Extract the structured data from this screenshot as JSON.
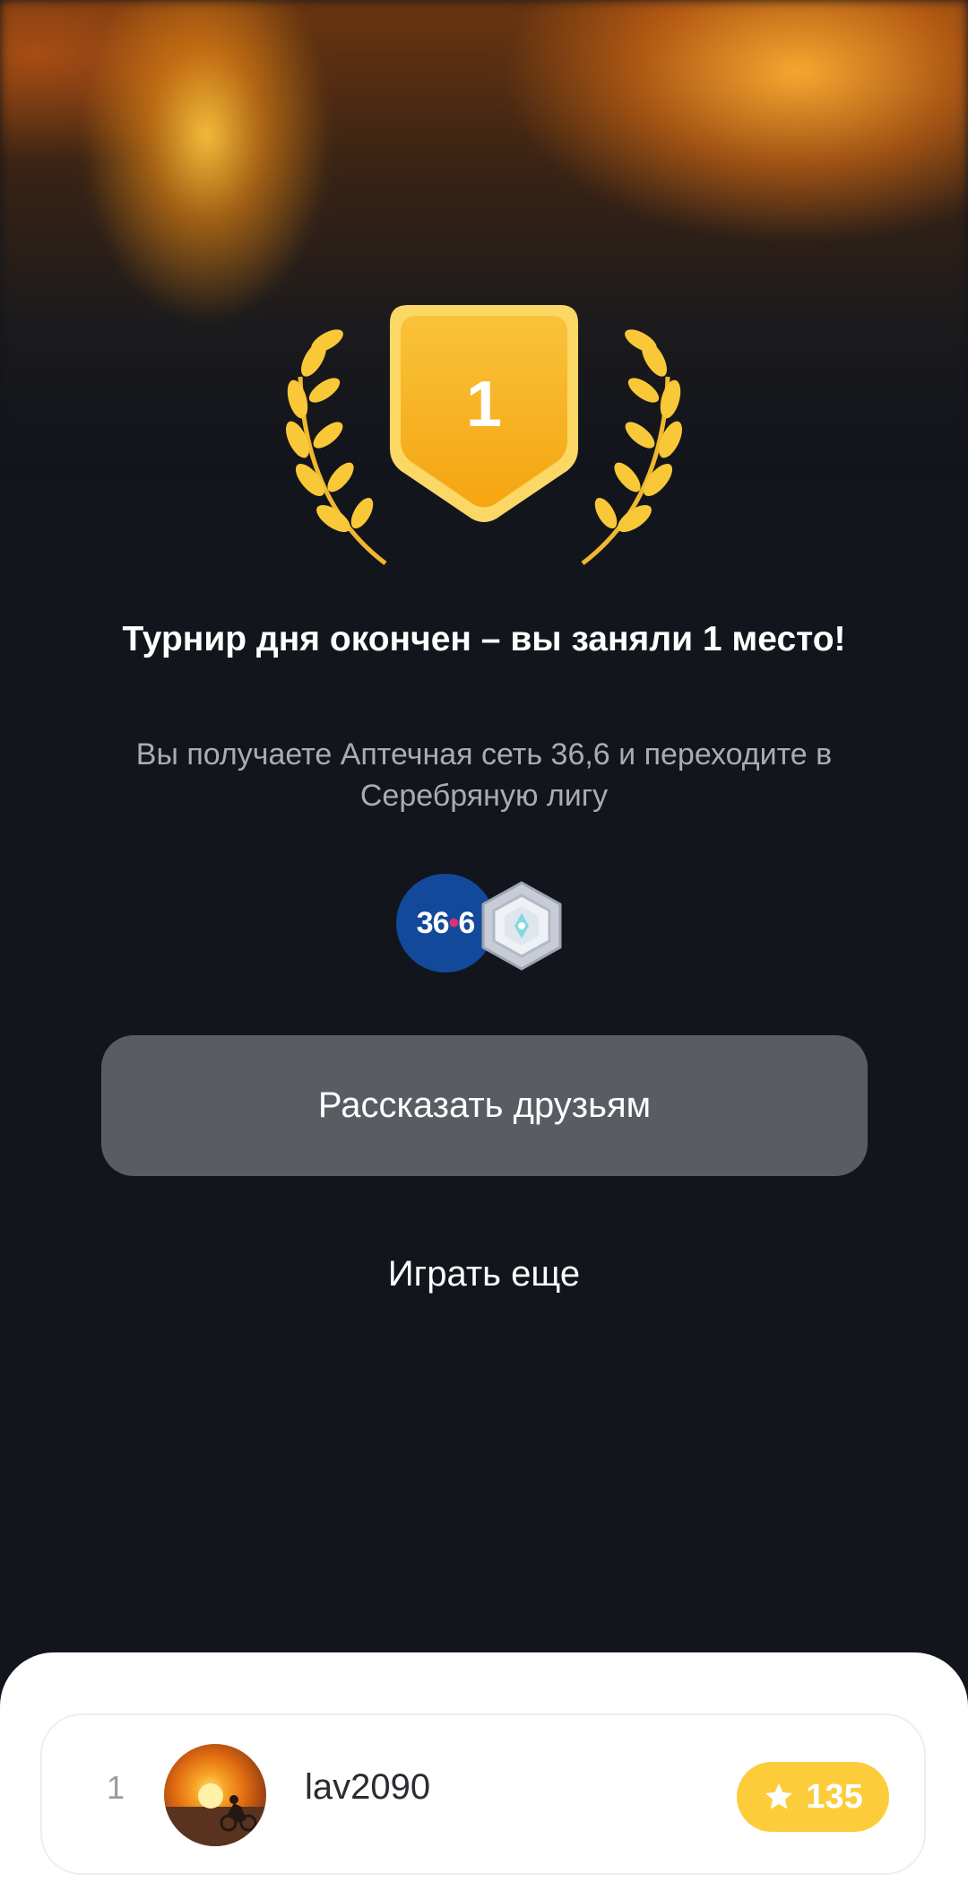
{
  "result": {
    "place_number": "1",
    "title": "Турнир дня окончен – вы заняли 1 место!",
    "subtitle": "Вы получаете Аптечная сеть 36,6 и переходите в Серебряную лигу"
  },
  "badges": {
    "pharmacy_logo_text_left": "36",
    "pharmacy_logo_dot": "•",
    "pharmacy_logo_text_right": "6",
    "league_icon": "silver-league-icon"
  },
  "actions": {
    "share_label": "Рассказать друзьям",
    "play_again_label": "Играть еще"
  },
  "leaderboard": {
    "rows": [
      {
        "rank": "1",
        "username": "lav2090",
        "score": "135",
        "score_icon": "star-icon"
      }
    ]
  },
  "colors": {
    "background": "#12151c",
    "gold": "#f5b820",
    "button": "#595c63",
    "score_pill": "#fccc3b",
    "pharmacy_blue": "#13499a"
  }
}
